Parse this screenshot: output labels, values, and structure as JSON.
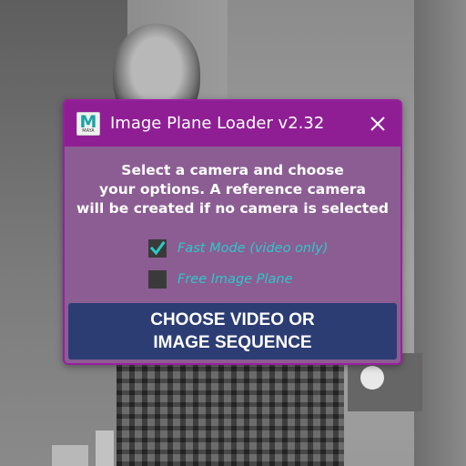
{
  "dialog": {
    "title": "Image Plane Loader v2.32",
    "app_icon": {
      "name": "maya-logo-icon",
      "letter": "M",
      "caption": "MAYA"
    },
    "close_icon": "close-icon",
    "message_lines": [
      "Select a camera and choose",
      "your options. A reference camera",
      "will be created if no camera is selected"
    ],
    "options": [
      {
        "label": "Fast Mode (video only)",
        "checked": true
      },
      {
        "label": "Free Image Plane",
        "checked": false
      }
    ],
    "action_button_lines": [
      "CHOOSE VIDEO OR",
      "IMAGE SEQUENCE"
    ]
  },
  "colors": {
    "titlebar": "#8f1e95",
    "dialog_body": "#8b5d93",
    "option_text": "#2ec8c8",
    "button": "#2c3d73"
  }
}
